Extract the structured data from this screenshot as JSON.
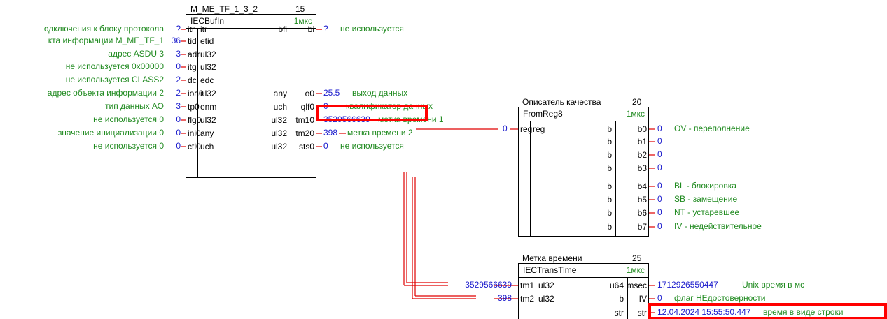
{
  "blocks": {
    "b1": {
      "name": "M_ME_TF_1_3_2",
      "num": "15",
      "type": "IECBufIn",
      "time": "1мкс",
      "in_pins": [
        "itr",
        "tid",
        "adr",
        "itg",
        "dcl",
        "ioa0",
        "tp0",
        "flg0",
        "ini0",
        "ctl0"
      ],
      "in_types": [
        "itr",
        "etid",
        "ul32",
        "ul32",
        "edc",
        "ul32",
        "enm",
        "ul32",
        "any",
        "uch"
      ],
      "out_types": [
        "bfi",
        "",
        "",
        "",
        "",
        "any",
        "uch",
        "ul32",
        "ul32",
        "ul32"
      ],
      "out_pins": [
        "bi",
        "",
        "",
        "",
        "",
        "o0",
        "qlf0",
        "tm10",
        "tm20",
        "sts0"
      ],
      "in_labels": [
        "одключения к блоку протокола",
        "кта информации  M_ME_TF_1",
        "адрес ASDU  3",
        "не используется  0x00000",
        "не используется  CLASS2",
        "адрес объекта информации  2",
        "тип данных  АО",
        "не используется  0",
        "значение инициализации  0",
        "не используется  0"
      ],
      "in_values": [
        "?",
        "36",
        "3",
        "0",
        "2",
        "2",
        "3",
        "0",
        "0",
        "0"
      ],
      "out_values": [
        "?",
        "",
        "",
        "",
        "",
        "25.5",
        "0",
        "3529566639",
        "398",
        "0"
      ],
      "out_labels": [
        "не используется",
        "",
        "",
        "",
        "",
        "выход данных",
        "квалификатор данных",
        "метка времени 1",
        "метка времени 2",
        "не используется"
      ]
    },
    "b2": {
      "name": "Описатель качества",
      "num": "20",
      "type": "FromReg8",
      "time": "1мкс",
      "in_pin": "reg",
      "in_type": "reg",
      "in_value": "0",
      "out_types": [
        "b",
        "b",
        "b",
        "b",
        "b",
        "b",
        "b",
        "b"
      ],
      "out_pins": [
        "b0",
        "b1",
        "b2",
        "b3",
        "b4",
        "b5",
        "b6",
        "b7"
      ],
      "out_values": [
        "0",
        "0",
        "0",
        "0",
        "0",
        "0",
        "0",
        "0"
      ],
      "out_labels": [
        "OV - переполнение",
        "",
        "",
        "",
        "BL - блокировка",
        "SB - замещение",
        "NT - устаревшее",
        "IV - недействительное"
      ]
    },
    "b3": {
      "name": "Метка времени",
      "num": "25",
      "type": "IECTransTime",
      "time": "1мкс",
      "in_pins": [
        "tm1",
        "tm2",
        ""
      ],
      "in_types": [
        "ul32",
        "ul32",
        ""
      ],
      "out_types": [
        "u64",
        "b",
        "str"
      ],
      "out_pins": [
        "msec",
        "IV",
        "str"
      ],
      "in_values": [
        "3529566639",
        "398",
        ""
      ],
      "out_values": [
        "1712926550447",
        "0",
        "12.04.2024 15:55:50.447"
      ],
      "out_labels": [
        "Unix время в мс",
        "флаг НЕдостоверности",
        "время в виде строки"
      ]
    }
  }
}
